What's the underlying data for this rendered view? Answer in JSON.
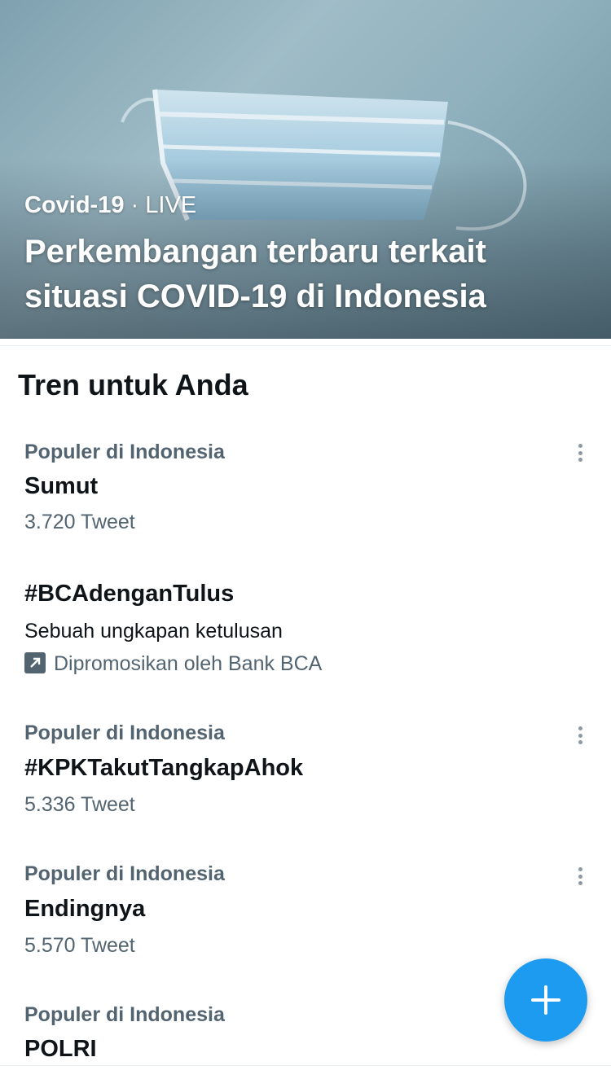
{
  "hero": {
    "topic": "Covid-19",
    "separator": "·",
    "status": "LIVE",
    "title": "Perkembangan terbaru terkait situasi COVID-19 di Indonesia"
  },
  "section_title": "Tren untuk Anda",
  "trends": [
    {
      "context": "Populer di Indonesia",
      "name": "Sumut",
      "count": "3.720 Tweet"
    },
    {
      "name": "#BCAdenganTulus",
      "description": "Sebuah ungkapan ketulusan",
      "promo": "Dipromosikan oleh Bank BCA",
      "promo_icon": "promoted-arrow-icon"
    },
    {
      "context": "Populer di Indonesia",
      "name": "#KPKTakutTangkapAhok",
      "count": "5.336 Tweet"
    },
    {
      "context": "Populer di Indonesia",
      "name": "Endingnya",
      "count": "5.570 Tweet"
    },
    {
      "context": "Populer di Indonesia",
      "name": "POLRI"
    }
  ],
  "icons": {
    "more": "more-vertical-icon",
    "compose": "plus-icon"
  },
  "colors": {
    "accent": "#1d9bf0",
    "secondary_text": "#536471",
    "primary_text": "#0f1419"
  }
}
